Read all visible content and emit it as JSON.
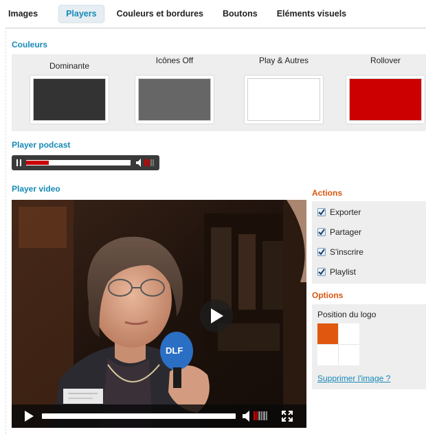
{
  "tabs": [
    {
      "label": "Images",
      "active": false
    },
    {
      "label": "Players",
      "active": true
    },
    {
      "label": "Couleurs et bordures",
      "active": false
    },
    {
      "label": "Boutons",
      "active": false
    },
    {
      "label": "Eléments visuels",
      "active": false
    }
  ],
  "colors": {
    "title": "Couleurs",
    "swatches": [
      {
        "label": "Dominante",
        "color": "#333333"
      },
      {
        "label": "Icônes Off",
        "color": "#666666"
      },
      {
        "label": "Play & Autres",
        "color": "#ffffff"
      },
      {
        "label": "Rollover",
        "color": "#cc0000"
      }
    ]
  },
  "podcast": {
    "title": "Player podcast",
    "progress": 0.22,
    "volume_bars_on": 3,
    "volume_bars_total": 5
  },
  "video": {
    "title": "Player video",
    "progress": 0,
    "volume_bars_on": 2,
    "volume_bars_total": 6,
    "icons": [
      "play-icon",
      "pause-icon",
      "volume-icon",
      "fullscreen-icon"
    ]
  },
  "actions": {
    "title": "Actions",
    "items": [
      {
        "label": "Exporter",
        "checked": true
      },
      {
        "label": "Partager",
        "checked": true
      },
      {
        "label": "S'inscrire",
        "checked": true
      },
      {
        "label": "Playlist",
        "checked": true
      }
    ]
  },
  "options": {
    "title": "Options",
    "logo_position_label": "Position du logo",
    "logo_position_selected": "top-left",
    "remove_image_link": "Supprimer l'image ?"
  },
  "accent_colors": {
    "blue": "#1689b6",
    "orange": "#d9560e"
  }
}
